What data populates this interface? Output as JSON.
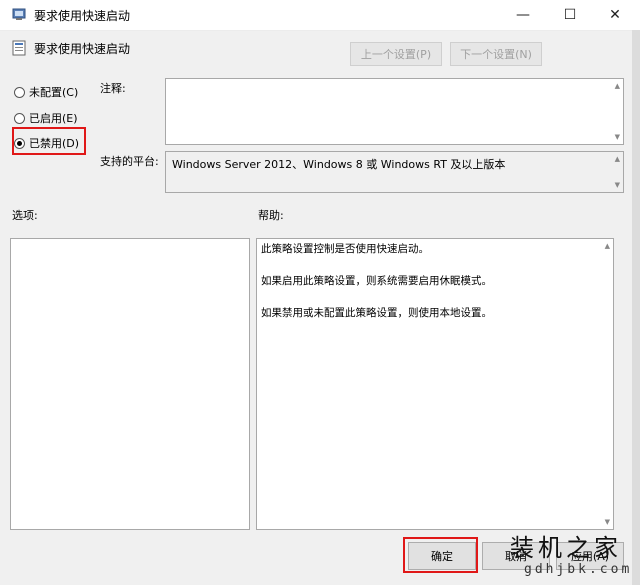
{
  "window": {
    "title": "要求使用快速启动",
    "minimize": "—",
    "maximize": "☐",
    "close": "✕"
  },
  "header": {
    "title": "要求使用快速启动",
    "prev_button": "上一个设置(P)",
    "next_button": "下一个设置(N)"
  },
  "options": {
    "not_configured": "未配置(C)",
    "enabled": "已启用(E)",
    "disabled": "已禁用(D)",
    "selected": "disabled"
  },
  "comment": {
    "label": "注释:",
    "value": ""
  },
  "platform": {
    "label": "支持的平台:",
    "value": "Windows Server 2012、Windows 8 或 Windows RT 及以上版本"
  },
  "options_section": {
    "label": "选项:"
  },
  "help_section": {
    "label": "帮助:",
    "paragraphs": [
      "此策略设置控制是否使用快速启动。",
      "如果启用此策略设置，则系统需要启用休眠模式。",
      "如果禁用或未配置此策略设置，则使用本地设置。"
    ]
  },
  "buttons": {
    "ok": "确定",
    "cancel": "取消",
    "apply": "应用(A)"
  },
  "watermark": {
    "main": "装机之家",
    "sub": "gdhjbk.com"
  },
  "colors": {
    "highlight": "#e01818",
    "dialog_bg": "#f0f0f0"
  }
}
